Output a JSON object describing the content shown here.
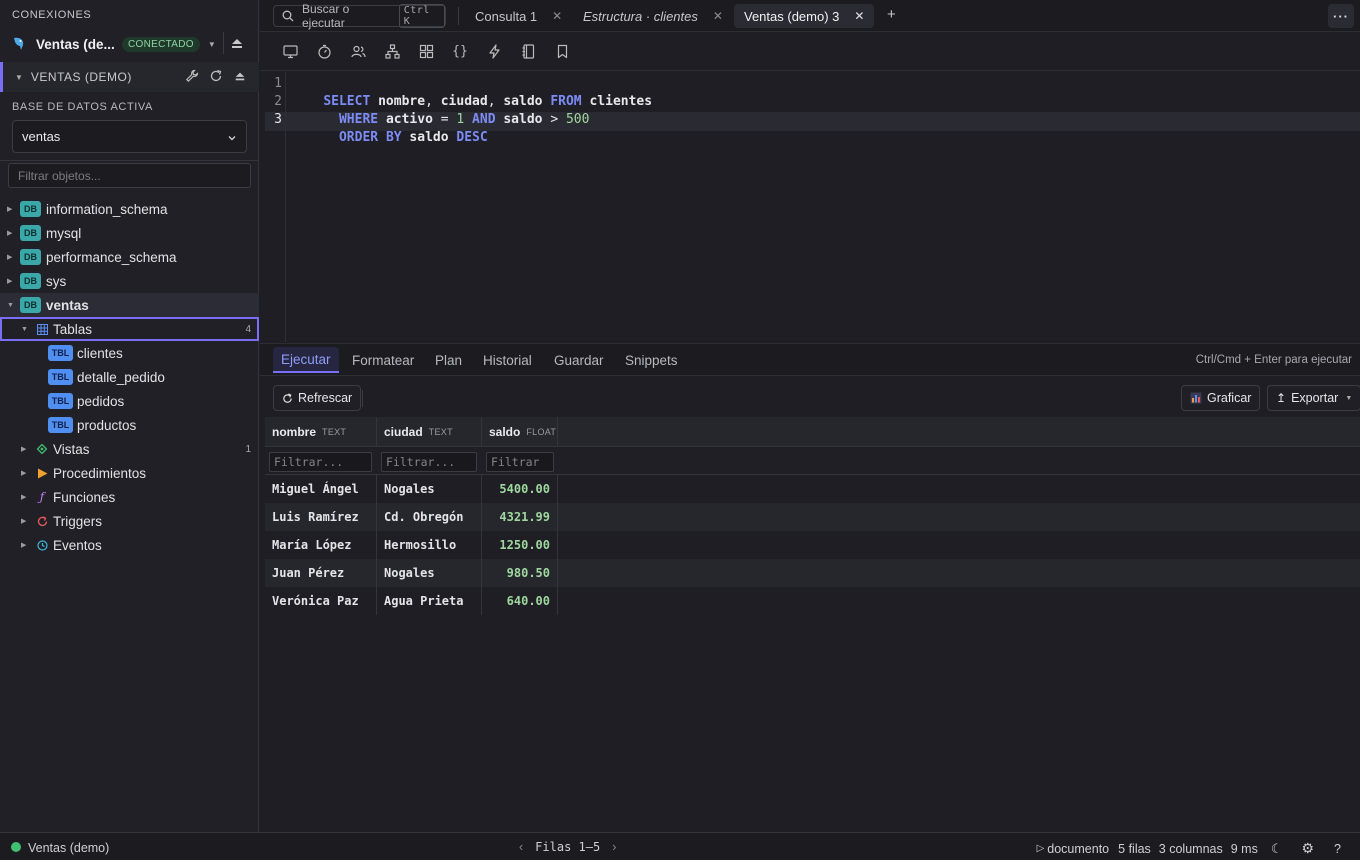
{
  "sidebar": {
    "header": "CONEXIONES",
    "connection": {
      "name": "Ventas (de...",
      "status": "CONECTADO"
    },
    "active_connection_label": "VENTAS (DEMO)",
    "active_db_label": "BASE DE DATOS ACTIVA",
    "active_db_value": "ventas",
    "filter_placeholder": "Filtrar objetos...",
    "db_badge": "DB",
    "tbl_badge": "TBL",
    "databases": [
      "information_schema",
      "mysql",
      "performance_schema",
      "sys",
      "ventas"
    ],
    "groups": {
      "tablas": {
        "label": "Tablas",
        "count": "4"
      },
      "vistas": {
        "label": "Vistas",
        "count": "1"
      },
      "procedimientos": {
        "label": "Procedimientos"
      },
      "funciones": {
        "label": "Funciones"
      },
      "triggers": {
        "label": "Triggers"
      },
      "eventos": {
        "label": "Eventos"
      }
    },
    "tables": [
      "clientes",
      "detalle_pedido",
      "pedidos",
      "productos"
    ]
  },
  "tabbar": {
    "search_label": "Buscar o ejecutar",
    "search_shortcut": "Ctrl K",
    "tabs": [
      {
        "label": "Consulta 1"
      },
      {
        "label": "Estructura · clientes"
      },
      {
        "label": "Ventas (demo) 3"
      }
    ],
    "new_tab": "+",
    "more": "···"
  },
  "editor": {
    "line_numbers": [
      "1",
      "2",
      "3"
    ],
    "lines": [
      [
        "SELECT",
        " ",
        "nombre",
        ", ",
        "ciudad",
        ", ",
        "saldo",
        " ",
        "FROM",
        " ",
        "clientes"
      ],
      [
        "  ",
        "WHERE",
        " ",
        "activo",
        " = ",
        "1",
        " ",
        "AND",
        " ",
        "saldo",
        " > ",
        "500"
      ],
      [
        "  ",
        "ORDER",
        " ",
        "BY",
        " ",
        "saldo",
        " ",
        "DESC"
      ]
    ]
  },
  "actions": {
    "tabs": [
      "Ejecutar",
      "Formatear",
      "Plan",
      "Historial",
      "Guardar",
      "Snippets"
    ],
    "hint": "Ctrl/Cmd + Enter para ejecutar"
  },
  "results": {
    "refresh_label": "Refrescar",
    "chart_label": "Graficar",
    "export_label": "Exportar",
    "columns": [
      {
        "name": "nombre",
        "type": "TEXT",
        "filter_placeholder": "Filtrar..."
      },
      {
        "name": "ciudad",
        "type": "TEXT",
        "filter_placeholder": "Filtrar..."
      },
      {
        "name": "saldo",
        "type": "FLOAT",
        "filter_placeholder": "Filtrar"
      }
    ],
    "rows": [
      [
        "Miguel Ángel",
        "Nogales",
        "5400.00"
      ],
      [
        "Luis Ramírez",
        "Cd. Obregón",
        "4321.99"
      ],
      [
        "María López",
        "Hermosillo",
        "1250.00"
      ],
      [
        "Juan Pérez",
        "Nogales",
        "980.50"
      ],
      [
        "Verónica Paz",
        "Agua Prieta",
        "640.00"
      ]
    ]
  },
  "status": {
    "connection": "Ventas (demo)",
    "pager": "Filas 1–5",
    "mode": "documento",
    "rows": "5 filas",
    "columns": "3 columnas",
    "time": "9 ms"
  },
  "colors": {
    "accent": "#7b6ef6",
    "keyword": "#7d8cf5",
    "number": "#9fd89f",
    "connected": "#3fbf72"
  }
}
